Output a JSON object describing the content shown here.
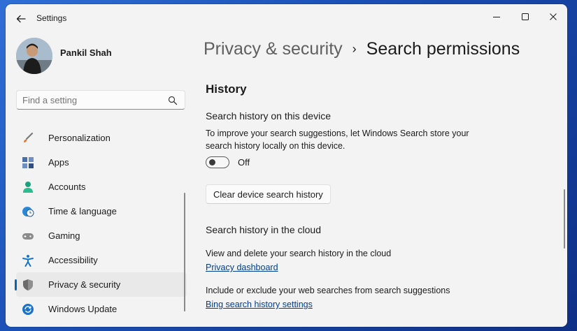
{
  "window": {
    "app_title": "Settings",
    "controls": [
      "minimize-icon",
      "maximize-icon",
      "close-icon"
    ]
  },
  "profile": {
    "name": "Pankil Shah"
  },
  "search": {
    "placeholder": "Find a setting"
  },
  "sidebar": {
    "items": [
      {
        "label": "Personalization",
        "icon": "paintbrush-icon",
        "color": "#e8772e"
      },
      {
        "label": "Apps",
        "icon": "apps-icon",
        "color": "#4a6ea8"
      },
      {
        "label": "Accounts",
        "icon": "person-icon",
        "color": "#1aa37a"
      },
      {
        "label": "Time & language",
        "icon": "globe-clock-icon",
        "color": "#2b88d8"
      },
      {
        "label": "Gaming",
        "icon": "gamepad-icon",
        "color": "#7a7a7a"
      },
      {
        "label": "Accessibility",
        "icon": "accessibility-icon",
        "color": "#1a73c9"
      },
      {
        "label": "Privacy & security",
        "icon": "shield-icon",
        "color": "#6b6b6b",
        "active": true
      },
      {
        "label": "Windows Update",
        "icon": "update-icon",
        "color": "#1a73c9"
      }
    ]
  },
  "breadcrumb": {
    "parent": "Privacy & security",
    "separator": "›",
    "current": "Search permissions"
  },
  "history": {
    "heading": "History",
    "device": {
      "title": "Search history on this device",
      "description": "To improve your search suggestions, let Windows Search store your search history locally on this device.",
      "toggle_state": "Off",
      "toggle_on": false,
      "clear_button": "Clear device search history"
    },
    "cloud": {
      "title": "Search history in the cloud",
      "view_text": "View and delete your search history in the cloud",
      "dashboard_link": "Privacy dashboard",
      "include_text": "Include or exclude your web searches from search suggestions",
      "bing_link": "Bing search history settings"
    }
  },
  "colors": {
    "accent": "#0067c0",
    "link": "#003e92"
  }
}
